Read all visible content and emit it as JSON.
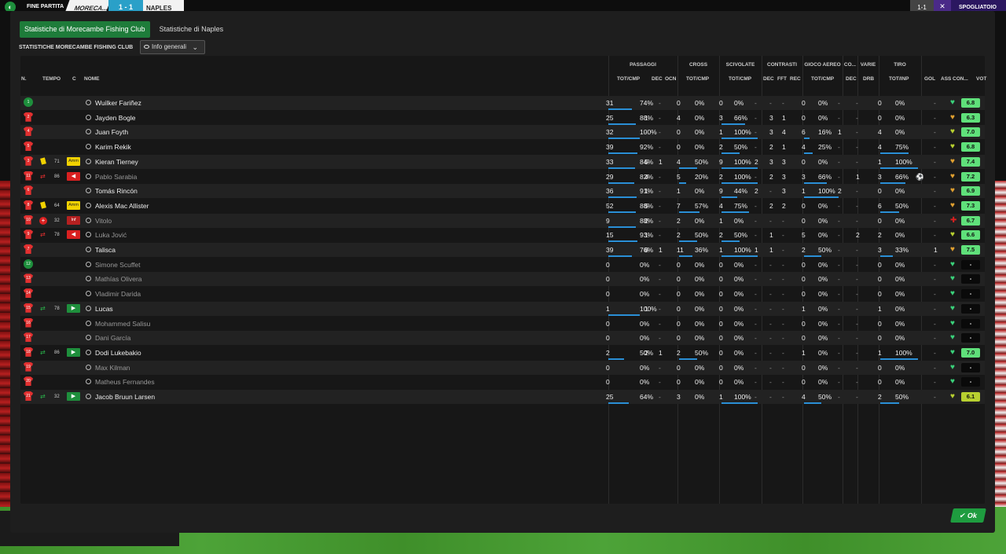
{
  "topbar": {
    "end_label": "FINE PARTITA",
    "home": "MORECA...",
    "score": "1 - 1",
    "away": "NAPLES",
    "aggregate": "1-1",
    "spogliatoio": "SPOGLIATOIO"
  },
  "tabs": [
    {
      "label": "Statistiche di Morecambe Fishing Club",
      "active": true
    },
    {
      "label": "Statistiche di Naples",
      "active": false
    }
  ],
  "subheader": "STATISTICHE MORECAMBE FISHING CLUB",
  "dropdown": {
    "selected": "Info generali"
  },
  "groups": {
    "passaggi": "PASSAGGI",
    "cross": "CROSS",
    "scivolate": "SCIVOLATE",
    "contrasti": "CONTRASTI",
    "aereo": "GIOCO AEREO",
    "co": "CO...",
    "varie": "VARIE",
    "tiro": "TIRO"
  },
  "cols": {
    "n": "N.",
    "tempo": "TEMPO",
    "c": "C",
    "nome": "NOME",
    "totcmp": "TOT/CMP",
    "dec": "DEC",
    "ocn": "OCN",
    "fft": "FFT",
    "rec": "REC",
    "drb": "DRB",
    "totinp": "TOT/INP",
    "gol": "GOL",
    "ass": "ASS",
    "con": "CON...",
    "vot": "VOT"
  },
  "rows": [
    {
      "n": "1",
      "gk": true,
      "name": "Wuilker Fariñez",
      "dim": false,
      "pass": "31",
      "passp": "74%",
      "pdec": "-",
      "pocn": "-",
      "cross": "0",
      "crossp": "0%",
      "sciv": "0",
      "scivp": "0%",
      "cdec": "-",
      "cfft": "-",
      "crec": "-",
      "aer": "0",
      "aerp": "0%",
      "co": "-",
      "drb": "-",
      "tiro": "0",
      "tirop": "0%",
      "gol": "",
      "ass": "-",
      "heart": "#3ad17a",
      "vote": "6.8",
      "vcol": "#5fe07a"
    },
    {
      "n": "2",
      "name": "Jayden Bogle",
      "dim": false,
      "pass": "25",
      "passp": "88%",
      "pdec": "1",
      "pocn": "-",
      "cross": "4",
      "crossp": "0%",
      "sciv": "3",
      "scivp": "66%",
      "cdec": "-",
      "cfft": "3",
      "crec": "1",
      "aer": "0",
      "aerp": "0%",
      "co": "-",
      "drb": "-",
      "tiro": "0",
      "tirop": "0%",
      "gol": "",
      "ass": "-",
      "heart": "#e0a030",
      "vote": "6.3",
      "vcol": "#5fe07a"
    },
    {
      "n": "4",
      "name": "Juan Foyth",
      "dim": false,
      "pass": "32",
      "passp": "100%",
      "pdec": "-",
      "pocn": "-",
      "cross": "0",
      "crossp": "0%",
      "sciv": "1",
      "scivp": "100%",
      "cdec": "-",
      "cfft": "3",
      "crec": "4",
      "aer": "6",
      "aerp": "16%",
      "co": "1",
      "drb": "-",
      "tiro": "4",
      "tirop": "0%",
      "gol": "",
      "ass": "-",
      "heart": "#b8d030",
      "vote": "7.0",
      "vcol": "#5fe07a"
    },
    {
      "n": "5",
      "name": "Karim Rekik",
      "dim": false,
      "pass": "39",
      "passp": "92%",
      "pdec": "-",
      "pocn": "-",
      "cross": "0",
      "crossp": "0%",
      "sciv": "2",
      "scivp": "50%",
      "cdec": "-",
      "cfft": "2",
      "crec": "1",
      "aer": "4",
      "aerp": "25%",
      "co": "-",
      "drb": "-",
      "tiro": "4",
      "tirop": "75%",
      "gol": "",
      "ass": "-",
      "heart": "#b8d030",
      "vote": "6.8",
      "vcol": "#5fe07a"
    },
    {
      "n": "3",
      "name": "Kieran Tierney",
      "dim": false,
      "yellow": true,
      "time": "71",
      "badge": "amm",
      "pass": "33",
      "passp": "84%",
      "pdec": "5",
      "pocn": "1",
      "cross": "4",
      "crossp": "50%",
      "sciv": "9",
      "scivp": "100%",
      "cdec": "2",
      "cfft": "3",
      "crec": "3",
      "aer": "0",
      "aerp": "0%",
      "co": "-",
      "drb": "-",
      "tiro": "1",
      "tirop": "100%",
      "gol": "",
      "ass": "-",
      "heart": "#e0a030",
      "vote": "7.4",
      "vcol": "#5fe07a"
    },
    {
      "n": "11",
      "name": "Pablo Sarabia",
      "dim": true,
      "sub": "out",
      "time": "86",
      "badge": "out",
      "pass": "29",
      "passp": "82%",
      "pdec": "4",
      "pocn": "-",
      "cross": "5",
      "crossp": "20%",
      "sciv": "2",
      "scivp": "100%",
      "cdec": "-",
      "cfft": "2",
      "crec": "3",
      "aer": "3",
      "aerp": "66%",
      "co": "-",
      "drb": "1",
      "tiro": "3",
      "tirop": "66%",
      "gol": "⚽",
      "ass": "-",
      "heart": "#e0a030",
      "vote": "7.2",
      "vcol": "#5fe07a"
    },
    {
      "n": "6",
      "name": "Tomás Rincón",
      "dim": false,
      "pass": "36",
      "passp": "91%",
      "pdec": "1",
      "pocn": "-",
      "cross": "1",
      "crossp": "0%",
      "sciv": "9",
      "scivp": "44%",
      "cdec": "2",
      "cfft": "-",
      "crec": "3",
      "aer": "1",
      "aerp": "100%",
      "co": "2",
      "drb": "-",
      "tiro": "0",
      "tirop": "0%",
      "gol": "",
      "ass": "-",
      "heart": "#e0a030",
      "vote": "6.9",
      "vcol": "#5fe07a"
    },
    {
      "n": "8",
      "name": "Alexis Mac Allister",
      "dim": false,
      "yellow": true,
      "time": "64",
      "badge": "amm",
      "pass": "52",
      "passp": "88%",
      "pdec": "5",
      "pocn": "-",
      "cross": "7",
      "crossp": "57%",
      "sciv": "4",
      "scivp": "75%",
      "cdec": "-",
      "cfft": "2",
      "crec": "2",
      "aer": "0",
      "aerp": "0%",
      "co": "-",
      "drb": "-",
      "tiro": "6",
      "tirop": "50%",
      "gol": "",
      "ass": "-",
      "heart": "#e0a030",
      "vote": "7.3",
      "vcol": "#5fe07a"
    },
    {
      "n": "10",
      "name": "Vitolo",
      "dim": true,
      "inj": true,
      "time": "32",
      "badge": "inf",
      "pass": "9",
      "passp": "88%",
      "pdec": "2",
      "pocn": "-",
      "cross": "2",
      "crossp": "0%",
      "sciv": "1",
      "scivp": "0%",
      "cdec": "-",
      "cfft": "-",
      "crec": "-",
      "aer": "0",
      "aerp": "0%",
      "co": "-",
      "drb": "-",
      "tiro": "0",
      "tirop": "0%",
      "gol": "",
      "ass": "-",
      "heart": "#d92020",
      "hinj": true,
      "vote": "6.7",
      "vcol": "#5fe07a"
    },
    {
      "n": "9",
      "name": "Luka Jović",
      "dim": true,
      "sub": "out",
      "time": "78",
      "badge": "out",
      "pass": "15",
      "passp": "93%",
      "pdec": "1",
      "pocn": "-",
      "cross": "2",
      "crossp": "50%",
      "sciv": "2",
      "scivp": "50%",
      "cdec": "-",
      "cfft": "1",
      "crec": "-",
      "aer": "5",
      "aerp": "0%",
      "co": "-",
      "drb": "2",
      "tiro": "2",
      "tirop": "0%",
      "gol": "",
      "ass": "-",
      "heart": "#b8d030",
      "vote": "6.6",
      "vcol": "#5fe07a"
    },
    {
      "n": "7",
      "name": "Talisca",
      "dim": false,
      "pass": "39",
      "passp": "76%",
      "pdec": "8",
      "pocn": "1",
      "cross": "11",
      "crossp": "36%",
      "sciv": "1",
      "scivp": "100%",
      "cdec": "1",
      "cfft": "1",
      "crec": "-",
      "aer": "2",
      "aerp": "50%",
      "co": "-",
      "drb": "-",
      "tiro": "3",
      "tirop": "33%",
      "gol": "",
      "ass": "1",
      "heart": "#e0a030",
      "vote": "7.5",
      "vcol": "#5fe07a"
    },
    {
      "n": "12",
      "gk": true,
      "name": "Simone Scuffet",
      "dim": true,
      "pass": "0",
      "passp": "0%",
      "pdec": "-",
      "pocn": "-",
      "cross": "0",
      "crossp": "0%",
      "sciv": "0",
      "scivp": "0%",
      "cdec": "-",
      "cfft": "-",
      "crec": "-",
      "aer": "0",
      "aerp": "0%",
      "co": "-",
      "drb": "-",
      "tiro": "0",
      "tirop": "0%",
      "gol": "",
      "ass": "-",
      "heart": "#3ad17a",
      "vote": "-",
      "vcol": "na"
    },
    {
      "n": "13",
      "name": "Mathías Olivera",
      "dim": true,
      "pass": "0",
      "passp": "0%",
      "pdec": "-",
      "pocn": "-",
      "cross": "0",
      "crossp": "0%",
      "sciv": "0",
      "scivp": "0%",
      "cdec": "-",
      "cfft": "-",
      "crec": "-",
      "aer": "0",
      "aerp": "0%",
      "co": "-",
      "drb": "-",
      "tiro": "0",
      "tirop": "0%",
      "gol": "",
      "ass": "-",
      "heart": "#3ad17a",
      "vote": "-",
      "vcol": "na"
    },
    {
      "n": "14",
      "name": "Vladimir Darida",
      "dim": true,
      "pass": "0",
      "passp": "0%",
      "pdec": "-",
      "pocn": "-",
      "cross": "0",
      "crossp": "0%",
      "sciv": "0",
      "scivp": "0%",
      "cdec": "-",
      "cfft": "-",
      "crec": "-",
      "aer": "0",
      "aerp": "0%",
      "co": "-",
      "drb": "-",
      "tiro": "0",
      "tirop": "0%",
      "gol": "",
      "ass": "-",
      "heart": "#3ad17a",
      "vote": "-",
      "vcol": "na"
    },
    {
      "n": "15",
      "name": "Lucas",
      "dim": false,
      "sub": "in",
      "time": "78",
      "badge": "in",
      "pass": "1",
      "passp": "100%",
      "pdec": "1",
      "pocn": "-",
      "cross": "0",
      "crossp": "0%",
      "sciv": "0",
      "scivp": "0%",
      "cdec": "-",
      "cfft": "-",
      "crec": "-",
      "aer": "1",
      "aerp": "0%",
      "co": "-",
      "drb": "-",
      "tiro": "1",
      "tirop": "0%",
      "gol": "",
      "ass": "-",
      "heart": "#3ad17a",
      "vote": "-",
      "vcol": "na"
    },
    {
      "n": "16",
      "name": "Mohammed Salisu",
      "dim": true,
      "pass": "0",
      "passp": "0%",
      "pdec": "-",
      "pocn": "-",
      "cross": "0",
      "crossp": "0%",
      "sciv": "0",
      "scivp": "0%",
      "cdec": "-",
      "cfft": "-",
      "crec": "-",
      "aer": "0",
      "aerp": "0%",
      "co": "-",
      "drb": "-",
      "tiro": "0",
      "tirop": "0%",
      "gol": "",
      "ass": "-",
      "heart": "#3ad17a",
      "vote": "-",
      "vcol": "na"
    },
    {
      "n": "17",
      "name": "Dani García",
      "dim": true,
      "pass": "0",
      "passp": "0%",
      "pdec": "-",
      "pocn": "-",
      "cross": "0",
      "crossp": "0%",
      "sciv": "0",
      "scivp": "0%",
      "cdec": "-",
      "cfft": "-",
      "crec": "-",
      "aer": "0",
      "aerp": "0%",
      "co": "-",
      "drb": "-",
      "tiro": "0",
      "tirop": "0%",
      "gol": "",
      "ass": "-",
      "heart": "#3ad17a",
      "vote": "-",
      "vcol": "na"
    },
    {
      "n": "18",
      "name": "Dodi Lukebakio",
      "dim": false,
      "sub": "in",
      "time": "86",
      "badge": "in",
      "pass": "2",
      "passp": "50%",
      "pdec": "2",
      "pocn": "1",
      "cross": "2",
      "crossp": "50%",
      "sciv": "0",
      "scivp": "0%",
      "cdec": "-",
      "cfft": "-",
      "crec": "-",
      "aer": "1",
      "aerp": "0%",
      "co": "-",
      "drb": "-",
      "tiro": "1",
      "tirop": "100%",
      "gol": "",
      "ass": "-",
      "heart": "#3ad17a",
      "vote": "7.0",
      "vcol": "#5fe07a"
    },
    {
      "n": "19",
      "name": "Max Kilman",
      "dim": true,
      "pass": "0",
      "passp": "0%",
      "pdec": "-",
      "pocn": "-",
      "cross": "0",
      "crossp": "0%",
      "sciv": "0",
      "scivp": "0%",
      "cdec": "-",
      "cfft": "-",
      "crec": "-",
      "aer": "0",
      "aerp": "0%",
      "co": "-",
      "drb": "-",
      "tiro": "0",
      "tirop": "0%",
      "gol": "",
      "ass": "-",
      "heart": "#3ad17a",
      "vote": "-",
      "vcol": "na"
    },
    {
      "n": "20",
      "name": "Matheus Fernandes",
      "dim": true,
      "pass": "0",
      "passp": "0%",
      "pdec": "-",
      "pocn": "-",
      "cross": "0",
      "crossp": "0%",
      "sciv": "0",
      "scivp": "0%",
      "cdec": "-",
      "cfft": "-",
      "crec": "-",
      "aer": "0",
      "aerp": "0%",
      "co": "-",
      "drb": "-",
      "tiro": "0",
      "tirop": "0%",
      "gol": "",
      "ass": "-",
      "heart": "#3ad17a",
      "vote": "-",
      "vcol": "na"
    },
    {
      "n": "21",
      "name": "Jacob Bruun Larsen",
      "dim": false,
      "sub": "in",
      "time": "32",
      "badge": "in",
      "pass": "25",
      "passp": "64%",
      "pdec": "-",
      "pocn": "-",
      "cross": "3",
      "crossp": "0%",
      "sciv": "1",
      "scivp": "100%",
      "cdec": "-",
      "cfft": "-",
      "crec": "-",
      "aer": "4",
      "aerp": "50%",
      "co": "-",
      "drb": "-",
      "tiro": "2",
      "tirop": "50%",
      "gol": "",
      "ass": "-",
      "heart": "#b8d030",
      "vote": "6.1",
      "vcol": "#b8d030"
    }
  ],
  "badges": {
    "amm": "Amm",
    "inf": "Inf",
    "out": "◀",
    "in": "▶"
  },
  "ok_label": "Ok"
}
